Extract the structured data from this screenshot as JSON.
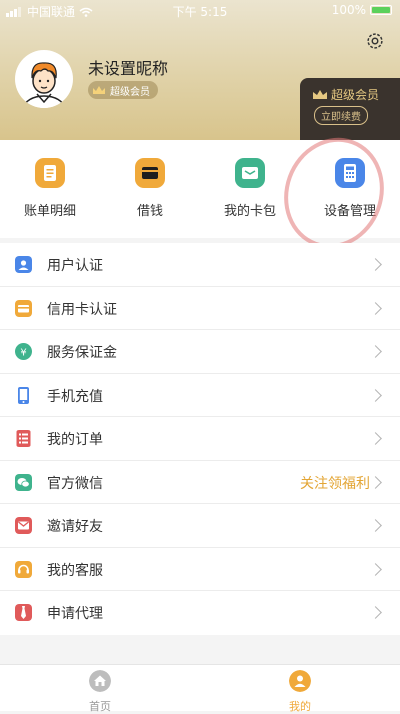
{
  "status_bar": {
    "carrier": "中国联通",
    "time": "下午 5:15",
    "battery": "100%"
  },
  "profile": {
    "nickname": "未设置昵称",
    "vip_badge": "超级会员"
  },
  "member_card": {
    "title": "超级会员",
    "renew_label": "立即续费"
  },
  "quick_actions": [
    {
      "label": "账单明细",
      "icon": "bill-icon",
      "color": "#f0a93a"
    },
    {
      "label": "借钱",
      "icon": "wallet-icon",
      "color": "#f0a93a"
    },
    {
      "label": "我的卡包",
      "icon": "card-pack-icon",
      "color": "#3fb38d"
    },
    {
      "label": "设备管理",
      "icon": "calculator-icon",
      "color": "#4a86e8"
    }
  ],
  "menu": [
    {
      "label": "用户认证",
      "icon": "user-verify-icon",
      "color": "#4a86e8"
    },
    {
      "label": "信用卡认证",
      "icon": "credit-card-icon",
      "color": "#f0a93a"
    },
    {
      "label": "服务保证金",
      "icon": "yen-icon",
      "color": "#3fb38d"
    },
    {
      "label": "手机充值",
      "icon": "phone-icon",
      "color": "#4a86e8"
    },
    {
      "label": "我的订单",
      "icon": "order-list-icon",
      "color": "#e05a5a"
    },
    {
      "label": "官方微信",
      "icon": "wechat-icon",
      "color": "#3fb38d",
      "extra": "关注领福利"
    },
    {
      "label": "邀请好友",
      "icon": "invite-mail-icon",
      "color": "#e05a5a"
    },
    {
      "label": "我的客服",
      "icon": "customer-service-icon",
      "color": "#f0a93a"
    },
    {
      "label": "申请代理",
      "icon": "agent-tie-icon",
      "color": "#e05a5a"
    }
  ],
  "tabbar": {
    "home_label": "首页",
    "mine_label": "我的",
    "active_color": "#f0a93a",
    "inactive_color": "#999999"
  }
}
